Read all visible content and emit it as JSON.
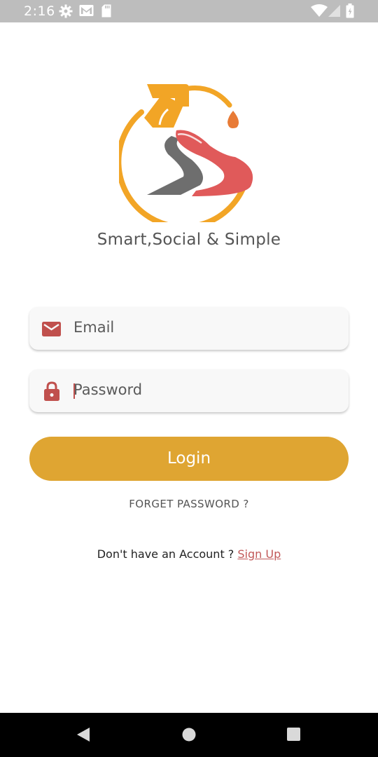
{
  "status_bar": {
    "time": "2:16",
    "icons": [
      "settings-icon",
      "gmail-icon",
      "sd-card-icon",
      "wifi-icon",
      "signal-icon",
      "battery-icon"
    ]
  },
  "app": {
    "logo": "fuel-nozzle-road-s-logo",
    "tagline": "Smart,Social & Simple"
  },
  "form": {
    "email": {
      "placeholder": "Email",
      "icon": "mail-icon"
    },
    "password": {
      "placeholder": "Password",
      "icon": "lock-icon"
    },
    "login_label": "Login",
    "forget_label": "FORGET PASSWORD ?",
    "signup_prompt": "Don't have an Account ? ",
    "signup_label": "Sign Up "
  },
  "nav_bar": {
    "buttons": [
      "back-icon",
      "home-icon",
      "recents-icon"
    ]
  },
  "colors": {
    "status_bar": "#bdbdbd",
    "accent": "#dfa532",
    "icon_red": "#c0504d",
    "logo_orange": "#f2a526",
    "logo_red": "#e05a5a",
    "logo_gray": "#6e6e6e",
    "link": "#c25a5a"
  }
}
